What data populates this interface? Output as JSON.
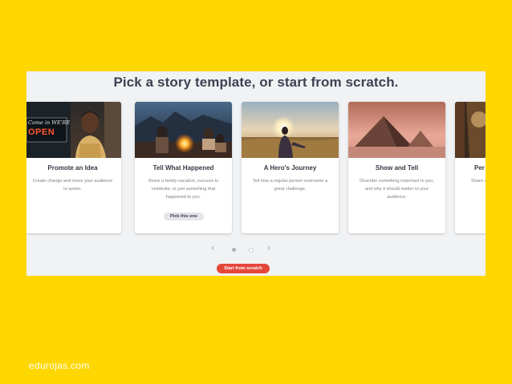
{
  "header": {
    "title": "Pick a story template, or start from scratch."
  },
  "cards": [
    {
      "title": "Promote an Idea",
      "desc": "Create change and move your audience to action.",
      "sign_top": "Come in WE'RE",
      "sign_bottom": "OPEN"
    },
    {
      "title": "Tell What Happened",
      "desc": "Share a family vacation, success to celebrate, or just something that happened to you.",
      "button": "Pick this one"
    },
    {
      "title": "A Hero's Journey",
      "desc": "Tell how a regular person overcame a great challenge."
    },
    {
      "title": "Show and Tell",
      "desc": "Describe something important to you, and why it should matter to your audience."
    },
    {
      "title": "Per",
      "desc": "Sharo chang"
    }
  ],
  "navigation": {
    "prev_icon": "chevron-left-icon",
    "next_icon": "chevron-right-icon",
    "prev_glyph": "‹",
    "next_glyph": "›",
    "pages": 2,
    "active_page": 1
  },
  "actions": {
    "start_from_scratch": "Start from scratch"
  },
  "footer": {
    "credit": "edurojas.com"
  },
  "colors": {
    "background": "#FED700",
    "accent": "#E4473A",
    "panel": "#F1F2F4"
  }
}
